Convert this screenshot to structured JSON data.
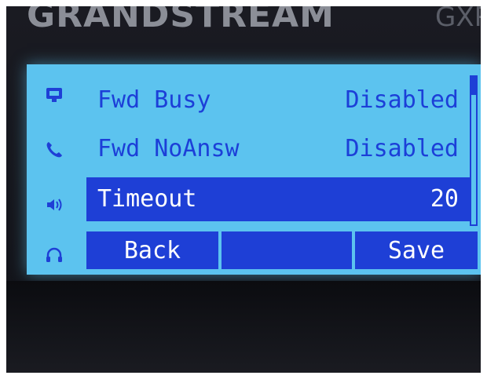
{
  "device": {
    "brand": "GRANDSTREAM",
    "model_partial": "GXP"
  },
  "menu": {
    "items": [
      {
        "label": "Fwd Busy",
        "value": "Disabled",
        "selected": false
      },
      {
        "label": "Fwd NoAnsw",
        "value": "Disabled",
        "selected": false
      },
      {
        "label": "Timeout",
        "value": "20",
        "selected": true
      }
    ]
  },
  "softkeys": [
    {
      "label": "Back"
    },
    {
      "label": ""
    },
    {
      "label": "Save"
    }
  ],
  "side_icons": [
    "network-icon",
    "phone-icon",
    "speaker-icon",
    "headset-icon"
  ],
  "scrollbar": {
    "position": 0.0,
    "visible_fraction": 0.12
  },
  "colors": {
    "screen_background": "#5cc3ef",
    "text_primary": "#1c3fd8",
    "highlight": "#1e3fd6",
    "highlight_text": "#ffffff"
  }
}
